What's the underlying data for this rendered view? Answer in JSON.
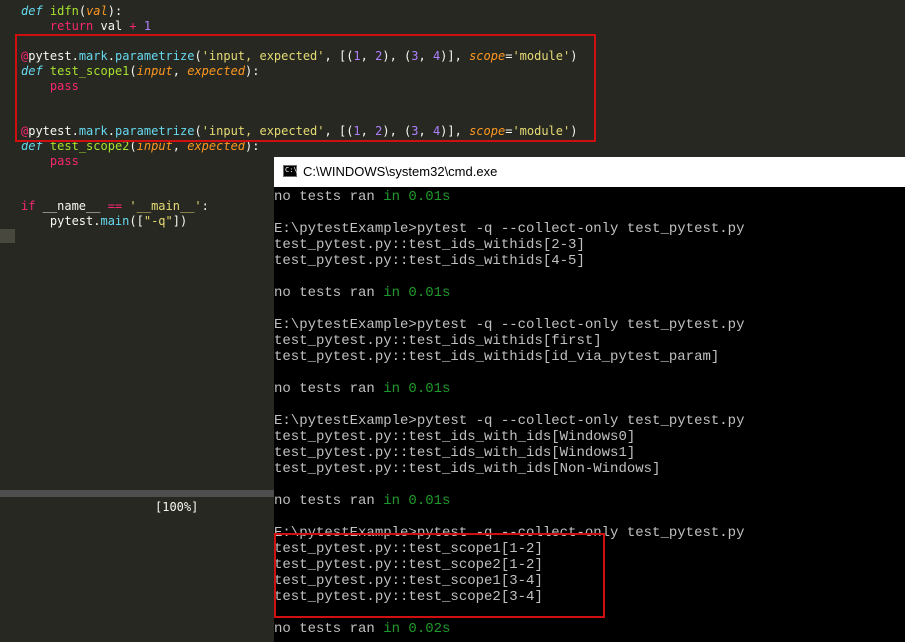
{
  "editor": {
    "lines": [
      [
        {
          "t": "def",
          "c": "kw"
        },
        {
          "t": " "
        },
        {
          "t": "idfn",
          "c": "fn"
        },
        {
          "t": "("
        },
        {
          "t": "val",
          "c": "param"
        },
        {
          "t": "):"
        }
      ],
      [
        {
          "t": "    "
        },
        {
          "t": "return",
          "c": "kw2"
        },
        {
          "t": " val "
        },
        {
          "t": "+",
          "c": "kw2"
        },
        {
          "t": " "
        },
        {
          "t": "1",
          "c": "num"
        }
      ],
      [],
      [
        {
          "t": "@",
          "c": "dec"
        },
        {
          "t": "pytest"
        },
        {
          "t": "."
        },
        {
          "t": "mark",
          "c": "attr"
        },
        {
          "t": "."
        },
        {
          "t": "parametrize",
          "c": "attr"
        },
        {
          "t": "("
        },
        {
          "t": "'input, expected'",
          "c": "str"
        },
        {
          "t": ", [("
        },
        {
          "t": "1",
          "c": "num"
        },
        {
          "t": ", "
        },
        {
          "t": "2",
          "c": "num"
        },
        {
          "t": "), ("
        },
        {
          "t": "3",
          "c": "num"
        },
        {
          "t": ", "
        },
        {
          "t": "4",
          "c": "num"
        },
        {
          "t": ")], "
        },
        {
          "t": "scope",
          "c": "param"
        },
        {
          "t": "="
        },
        {
          "t": "'module'",
          "c": "str"
        },
        {
          "t": ")"
        }
      ],
      [
        {
          "t": "def",
          "c": "kw"
        },
        {
          "t": " "
        },
        {
          "t": "test_scope1",
          "c": "fn"
        },
        {
          "t": "("
        },
        {
          "t": "input",
          "c": "param"
        },
        {
          "t": ", "
        },
        {
          "t": "expected",
          "c": "param"
        },
        {
          "t": "):"
        }
      ],
      [
        {
          "t": "    "
        },
        {
          "t": "pass",
          "c": "kw2"
        }
      ],
      [],
      [],
      [
        {
          "t": "@",
          "c": "dec"
        },
        {
          "t": "pytest"
        },
        {
          "t": "."
        },
        {
          "t": "mark",
          "c": "attr"
        },
        {
          "t": "."
        },
        {
          "t": "parametrize",
          "c": "attr"
        },
        {
          "t": "("
        },
        {
          "t": "'input, expected'",
          "c": "str"
        },
        {
          "t": ", [("
        },
        {
          "t": "1",
          "c": "num"
        },
        {
          "t": ", "
        },
        {
          "t": "2",
          "c": "num"
        },
        {
          "t": "), ("
        },
        {
          "t": "3",
          "c": "num"
        },
        {
          "t": ", "
        },
        {
          "t": "4",
          "c": "num"
        },
        {
          "t": ")], "
        },
        {
          "t": "scope",
          "c": "param"
        },
        {
          "t": "="
        },
        {
          "t": "'module'",
          "c": "str"
        },
        {
          "t": ")"
        }
      ],
      [
        {
          "t": "def",
          "c": "kw"
        },
        {
          "t": " "
        },
        {
          "t": "test_scope2",
          "c": "fn"
        },
        {
          "t": "("
        },
        {
          "t": "input",
          "c": "param"
        },
        {
          "t": ", "
        },
        {
          "t": "expected",
          "c": "param"
        },
        {
          "t": "):"
        }
      ],
      [
        {
          "t": "    "
        },
        {
          "t": "pass",
          "c": "kw2"
        }
      ],
      [],
      [],
      [
        {
          "t": "if",
          "c": "kw2"
        },
        {
          "t": " __name__ "
        },
        {
          "t": "==",
          "c": "kw2"
        },
        {
          "t": " "
        },
        {
          "t": "'__main__'",
          "c": "str"
        },
        {
          "t": ":"
        }
      ],
      [
        {
          "t": "    pytest."
        },
        {
          "t": "main",
          "c": "attr"
        },
        {
          "t": "(["
        },
        {
          "t": "\"-q\"",
          "c": "str"
        },
        {
          "t": "])"
        }
      ]
    ],
    "status_progress": "[100%]"
  },
  "cmd": {
    "title": "C:\\WINDOWS\\system32\\cmd.exe",
    "icon_glyph": "C:\\",
    "lines": [
      [
        {
          "t": "no tests ran "
        },
        {
          "t": "in 0.01s",
          "c": "grn"
        }
      ],
      [],
      [
        {
          "t": "E:\\pytestExample>pytest -q --collect-only test_pytest.py"
        }
      ],
      [
        {
          "t": "test_pytest.py::test_ids_withids[2-3]"
        }
      ],
      [
        {
          "t": "test_pytest.py::test_ids_withids[4-5]"
        }
      ],
      [],
      [
        {
          "t": "no tests ran "
        },
        {
          "t": "in 0.01s",
          "c": "grn"
        }
      ],
      [],
      [
        {
          "t": "E:\\pytestExample>pytest -q --collect-only test_pytest.py"
        }
      ],
      [
        {
          "t": "test_pytest.py::test_ids_withids[first]"
        }
      ],
      [
        {
          "t": "test_pytest.py::test_ids_withids[id_via_pytest_param]"
        }
      ],
      [],
      [
        {
          "t": "no tests ran "
        },
        {
          "t": "in 0.01s",
          "c": "grn"
        }
      ],
      [],
      [
        {
          "t": "E:\\pytestExample>pytest -q --collect-only test_pytest.py"
        }
      ],
      [
        {
          "t": "test_pytest.py::test_ids_with_ids[Windows0]"
        }
      ],
      [
        {
          "t": "test_pytest.py::test_ids_with_ids[Windows1]"
        }
      ],
      [
        {
          "t": "test_pytest.py::test_ids_with_ids[Non-Windows]"
        }
      ],
      [],
      [
        {
          "t": "no tests ran "
        },
        {
          "t": "in 0.01s",
          "c": "grn"
        }
      ],
      [],
      [
        {
          "t": "E:\\pytestExample>pytest -q --collect-only test_pytest.py"
        }
      ],
      [
        {
          "t": "test_pytest.py::test_scope1[1-2]"
        }
      ],
      [
        {
          "t": "test_pytest.py::test_scope2[1-2]"
        }
      ],
      [
        {
          "t": "test_pytest.py::test_scope1[3-4]"
        }
      ],
      [
        {
          "t": "test_pytest.py::test_scope2[3-4]"
        }
      ],
      [],
      [
        {
          "t": "no tests ran "
        },
        {
          "t": "in 0.02s",
          "c": "grn"
        }
      ]
    ]
  },
  "colors": {
    "editor_bg": "#272822",
    "highlight_box": "#d01010",
    "cmd_bg": "#000000",
    "cmd_text": "#c0c0c0",
    "cmd_green": "#1f9a2b"
  }
}
